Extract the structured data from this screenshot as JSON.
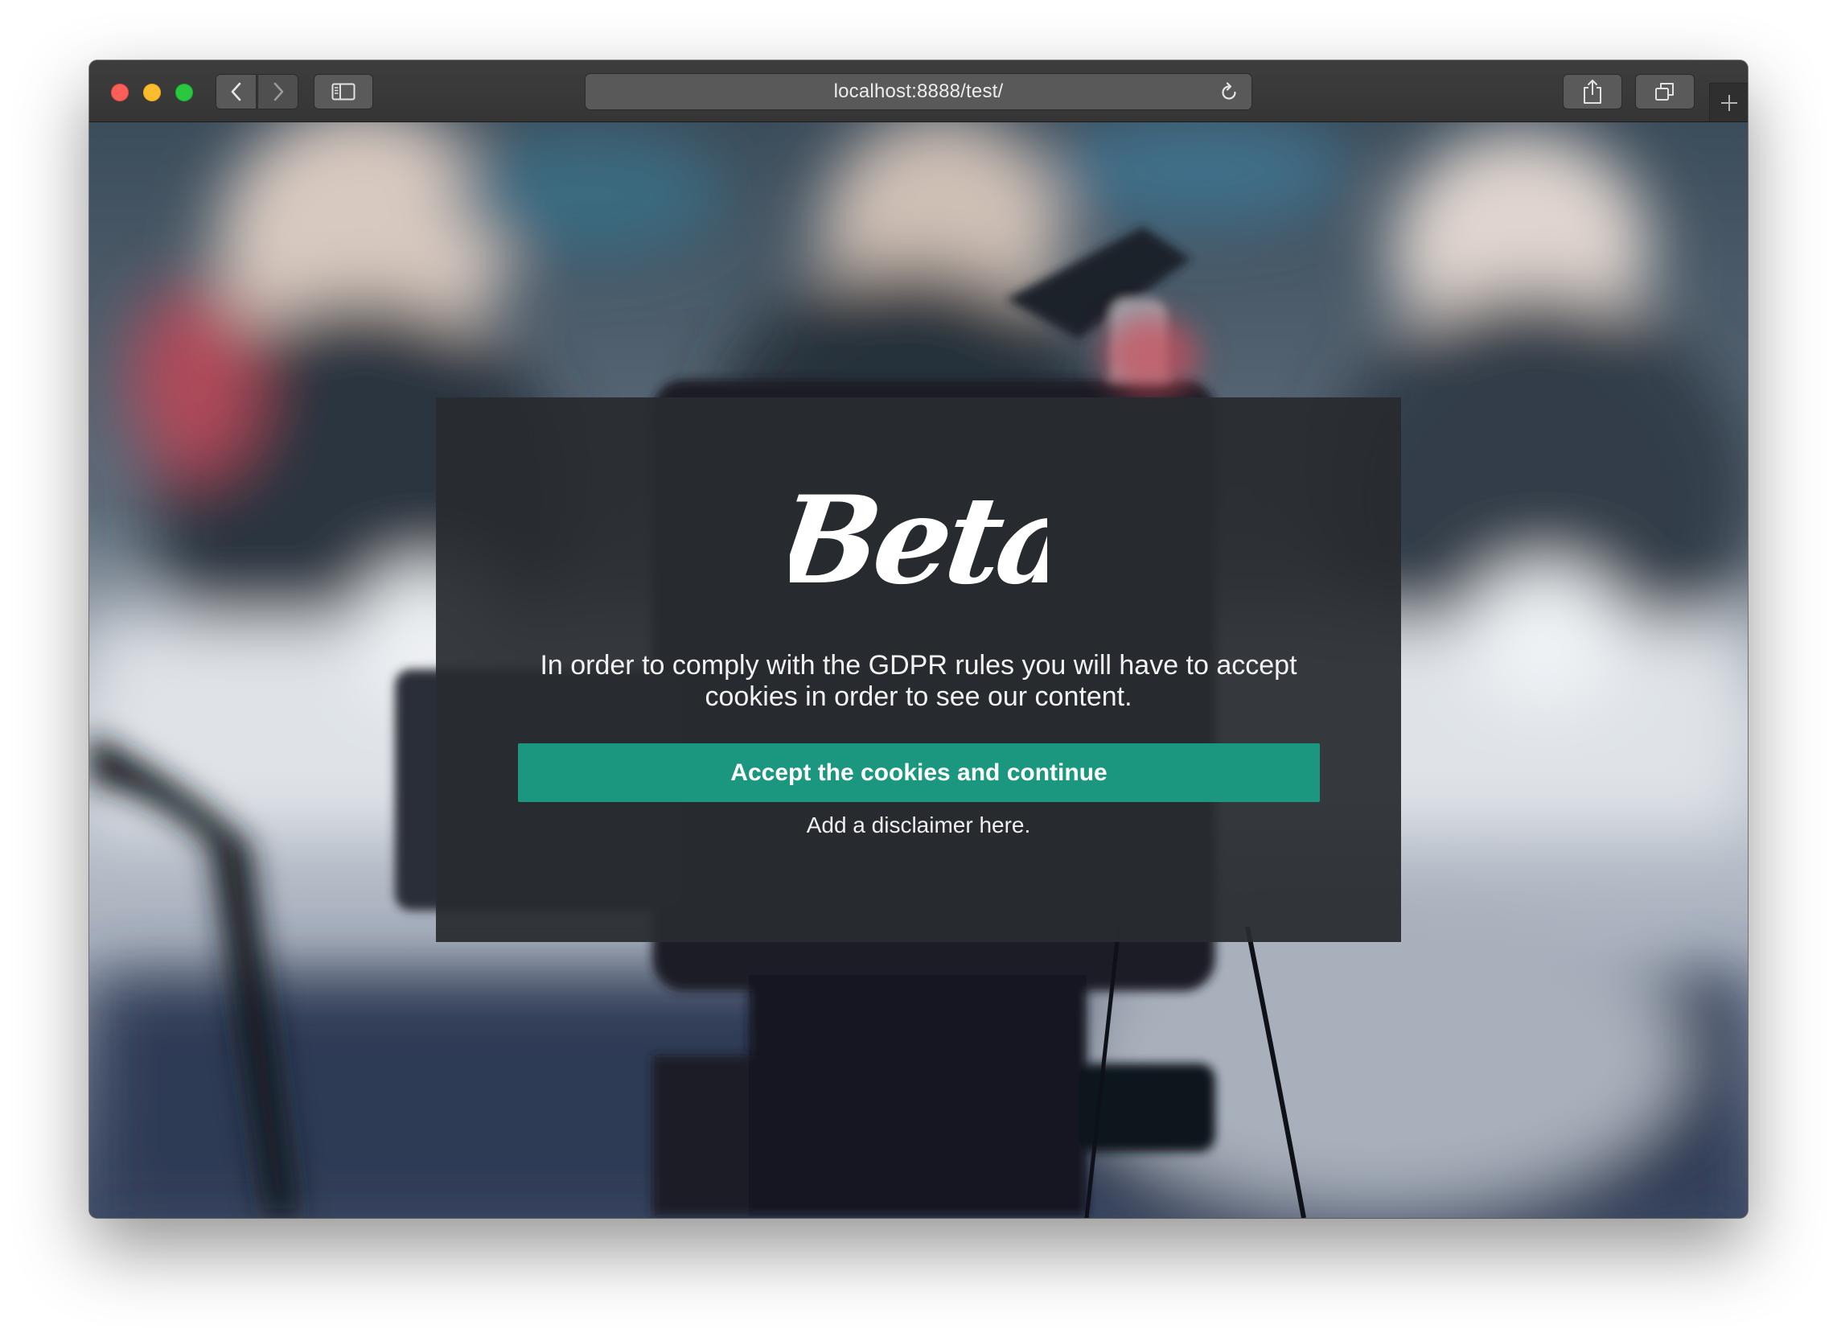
{
  "browser": {
    "url": "localhost:8888/test/",
    "controls": {
      "close": "red",
      "minimize": "yellow",
      "zoom": "green"
    },
    "icons": [
      "back-arrow-icon",
      "forward-arrow-icon",
      "sidebar-icon",
      "reload-icon",
      "share-icon",
      "tabs-icon",
      "plus-icon"
    ]
  },
  "modal": {
    "logo_text": "Beta",
    "message": "In order to comply with the GDPR rules you will have to accept cookies in order to see our content.",
    "accept_label": "Accept the cookies and continue",
    "disclaimer": "Add a disclaimer here."
  },
  "colors": {
    "accent": "#1a977e",
    "modal_bg": "#282b2f",
    "toolbar_bg": "#3a3a3a"
  }
}
